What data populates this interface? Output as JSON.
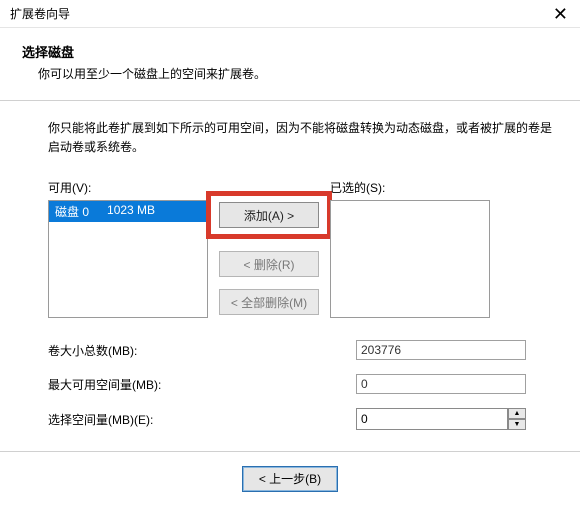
{
  "window": {
    "title": "扩展卷向导",
    "close_glyph": "✕"
  },
  "header": {
    "title": "选择磁盘",
    "subtitle": "你可以用至少一个磁盘上的空间来扩展卷。"
  },
  "description": "你只能将此卷扩展到如下所示的可用空间，因为不能将磁盘转换为动态磁盘，或者被扩展的卷是启动卷或系统卷。",
  "lists": {
    "available_label": "可用(V):",
    "selected_label": "已选的(S):",
    "available_items": [
      {
        "name": "磁盘 0",
        "size": "1023 MB"
      }
    ]
  },
  "buttons": {
    "add": "添加(A) >",
    "remove": "< 删除(R)",
    "remove_all": "< 全部删除(M)",
    "back": "< 上一步(B)"
  },
  "fields": {
    "total_label": "卷大小总数(MB):",
    "total_value": "203776",
    "max_label": "最大可用空间量(MB):",
    "max_value": "0",
    "select_label": "选择空间量(MB)(E):",
    "select_value": "0"
  }
}
